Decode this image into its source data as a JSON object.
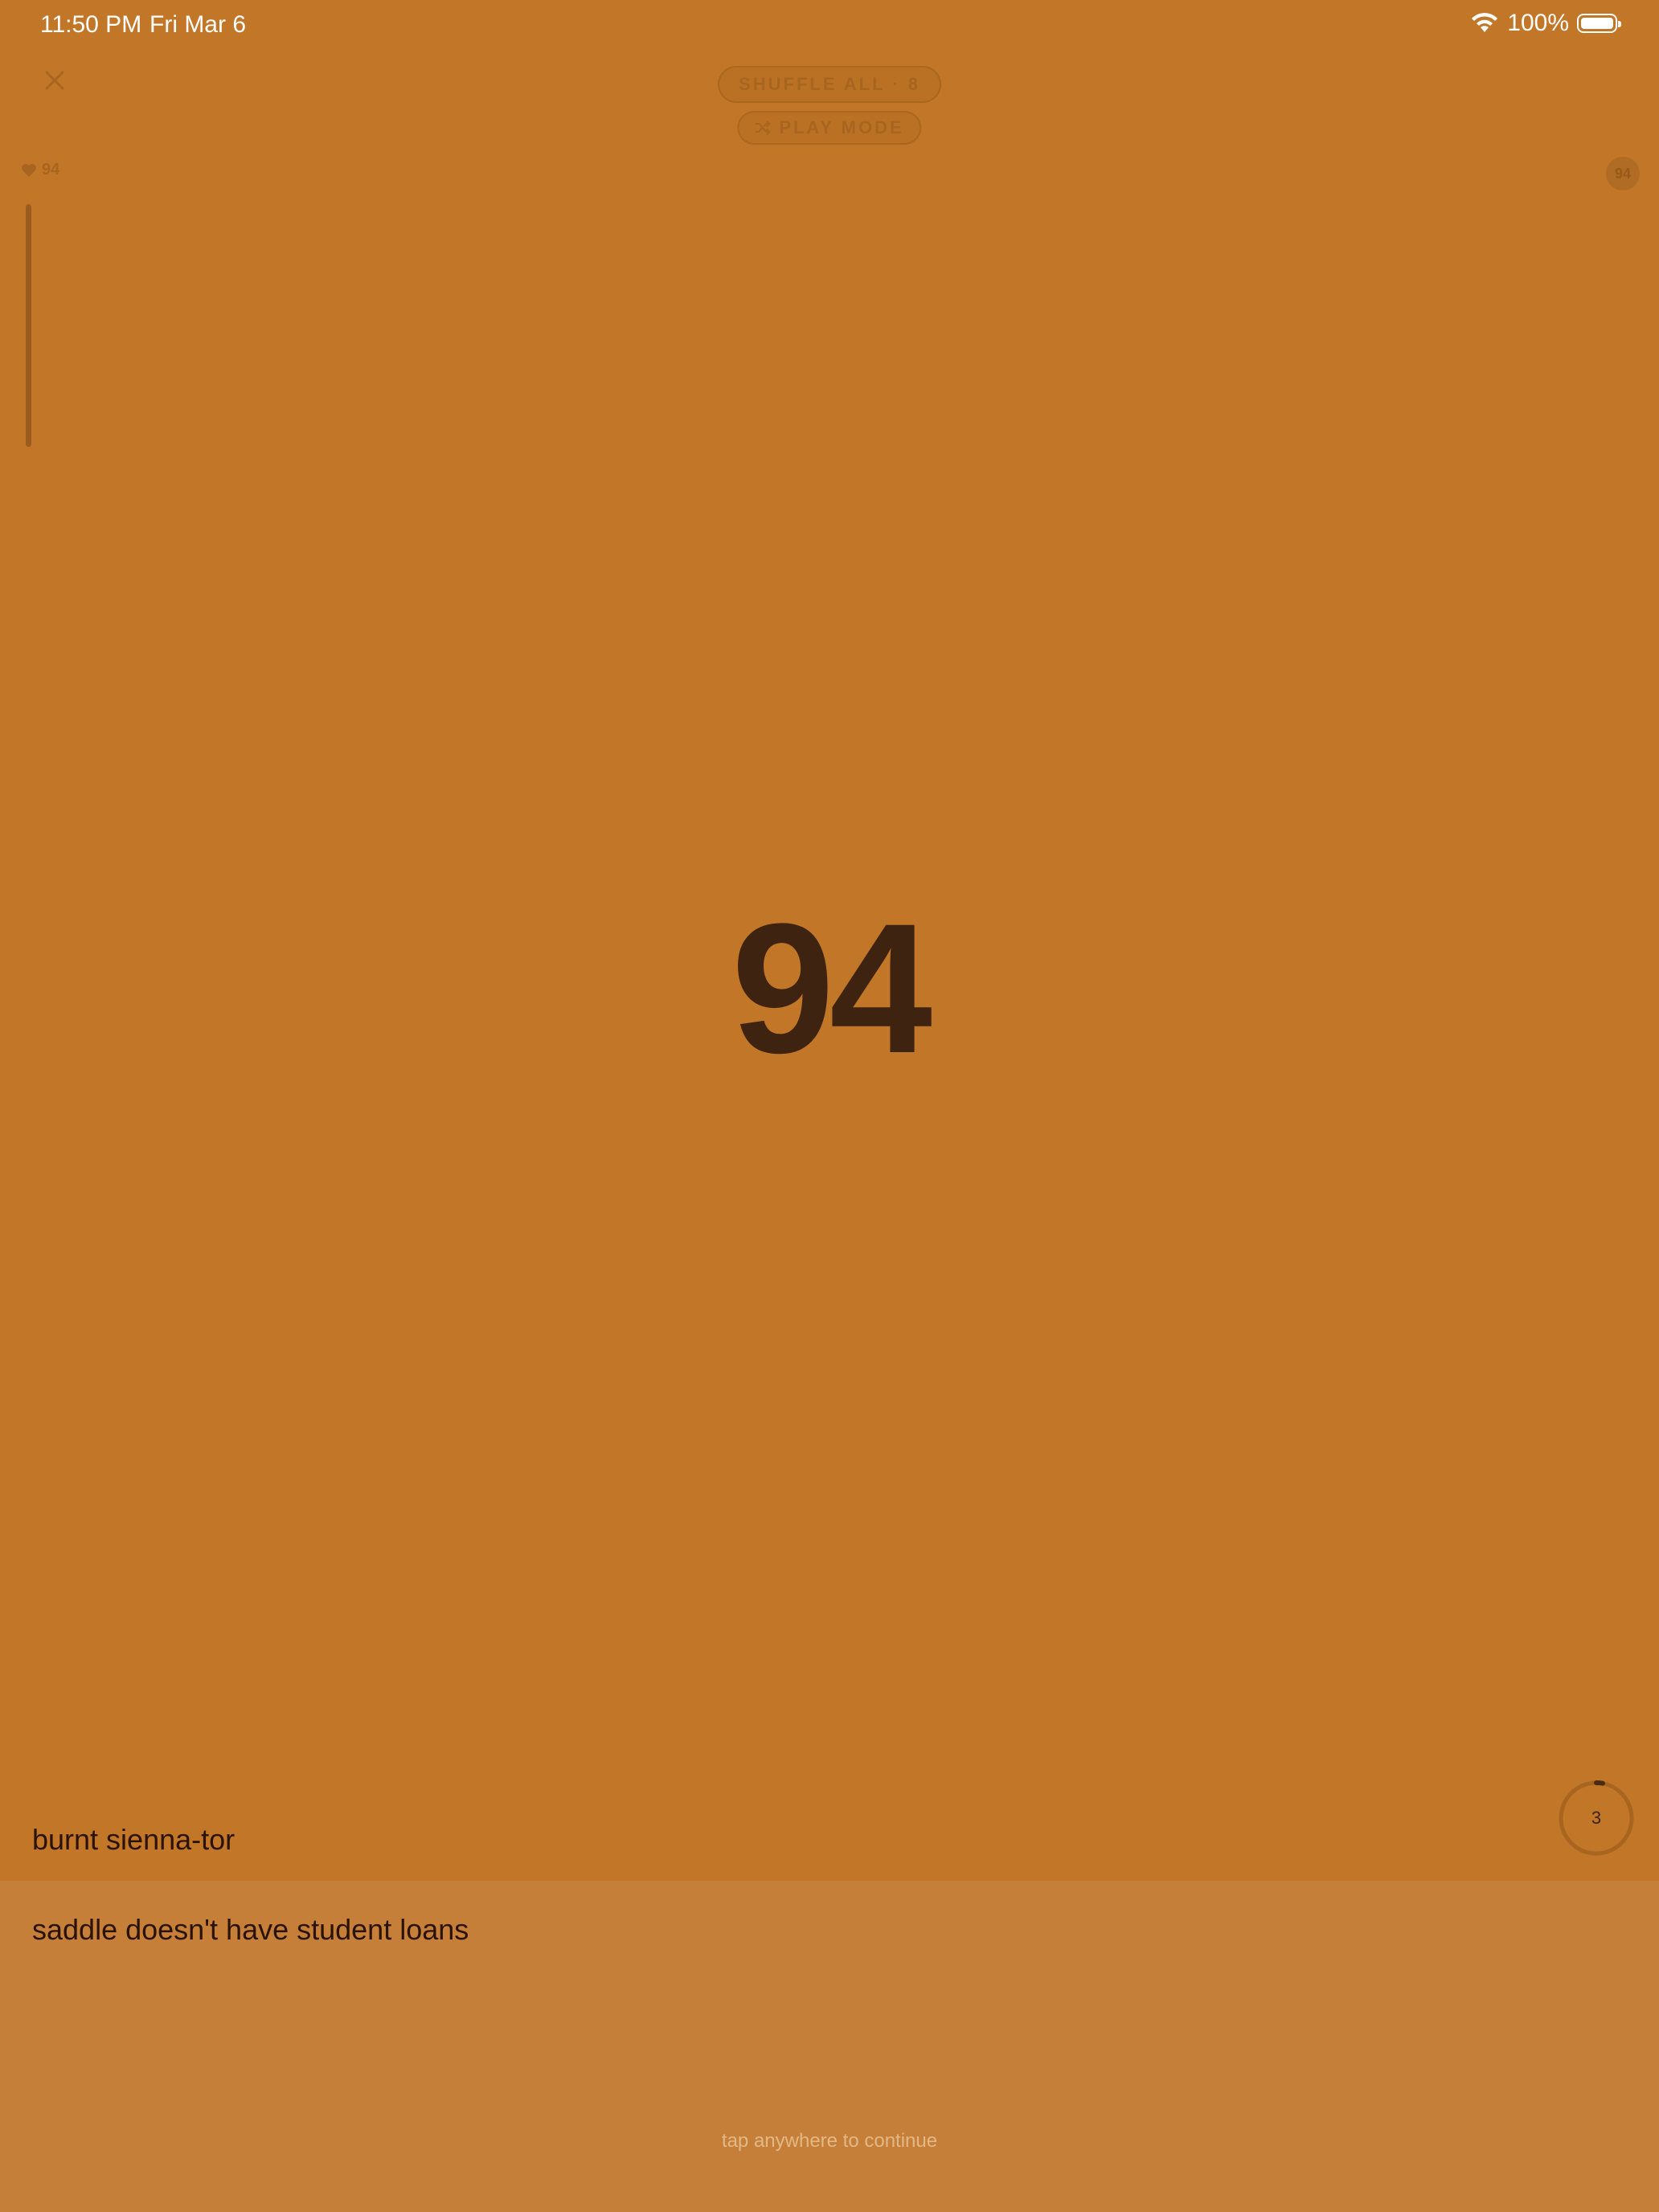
{
  "status_bar": {
    "time": "11:50 PM",
    "date": "Fri Mar 6",
    "battery": "100%"
  },
  "controls": {
    "shuffle_label": "SHUFFLE ALL · 8",
    "play_mode_label": "PLAY MODE",
    "favorite_count": "94",
    "score_badge": "94"
  },
  "main": {
    "big_number": "94",
    "timer_value": "3",
    "color_name": "burnt sienna-tor",
    "caption": "saddle doesn't have student loans",
    "hint": "tap anywhere to continue"
  },
  "theme": {
    "background": "#c27628",
    "panel": "#c57f38",
    "number_color": "#3e2410"
  }
}
